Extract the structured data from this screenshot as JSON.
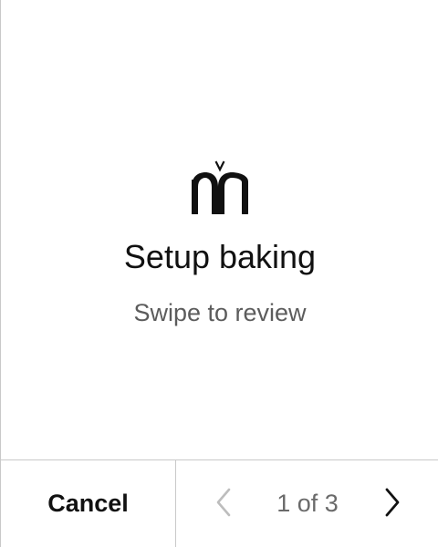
{
  "app": {
    "logo_icon": "brand-logo-icon",
    "title": "Setup baking",
    "subtitle": "Swipe to review"
  },
  "footer": {
    "cancel_label": "Cancel",
    "pager": {
      "prev_icon": "chevron-left-icon",
      "next_icon": "chevron-right-icon",
      "current_page": 1,
      "total_pages": 3,
      "indicator_text": "1 of 3",
      "prev_enabled": false,
      "next_enabled": true
    }
  },
  "colors": {
    "background": "#ffffff",
    "text_primary": "#111111",
    "text_secondary": "#5c5c5c",
    "divider": "#c9c9c9",
    "chevron_disabled": "#bdbdbd",
    "chevron_enabled": "#111111"
  }
}
